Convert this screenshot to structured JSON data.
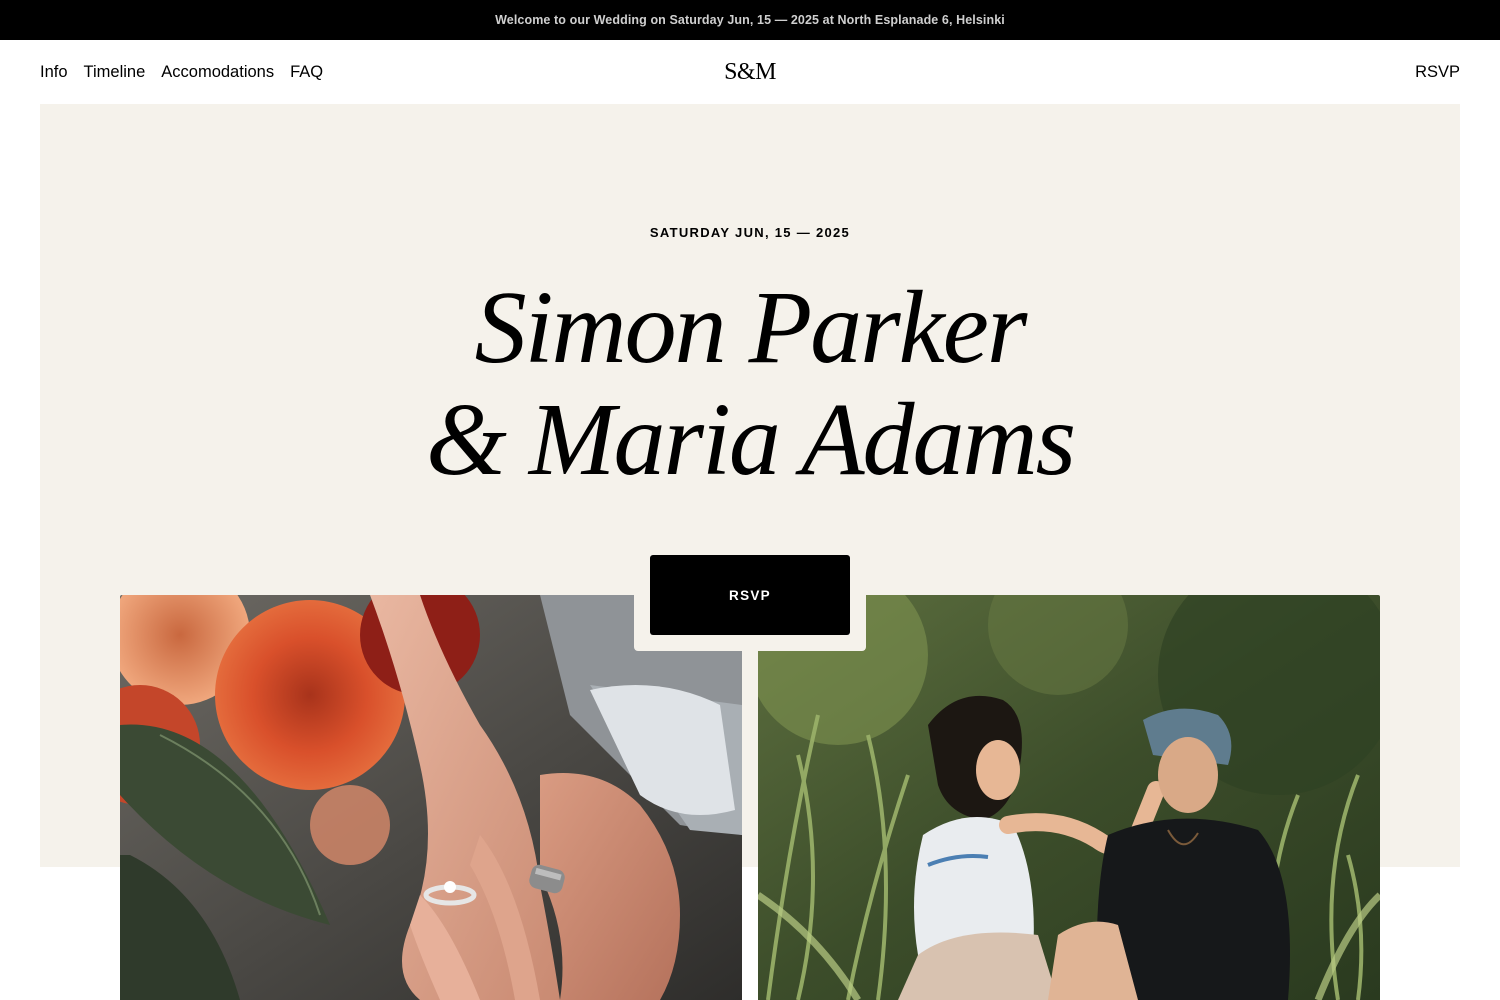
{
  "announcement": "Welcome to our Wedding on Saturday Jun, 15 — 2025 at North Esplanade 6, Helsinki",
  "nav": {
    "links": [
      "Info",
      "Timeline",
      "Accomodations",
      "FAQ"
    ],
    "logo": "S&M",
    "rsvp": "RSVP"
  },
  "hero": {
    "date": "SATURDAY JUN, 15 — 2025",
    "headline_line1": "Simon Parker",
    "headline_line2": "& Maria Adams",
    "rsvp_button": "RSVP"
  },
  "colors": {
    "announcement_bg": "#000000",
    "hero_bg": "#f5f2eb",
    "button_bg": "#000000",
    "button_text": "#ffffff"
  }
}
